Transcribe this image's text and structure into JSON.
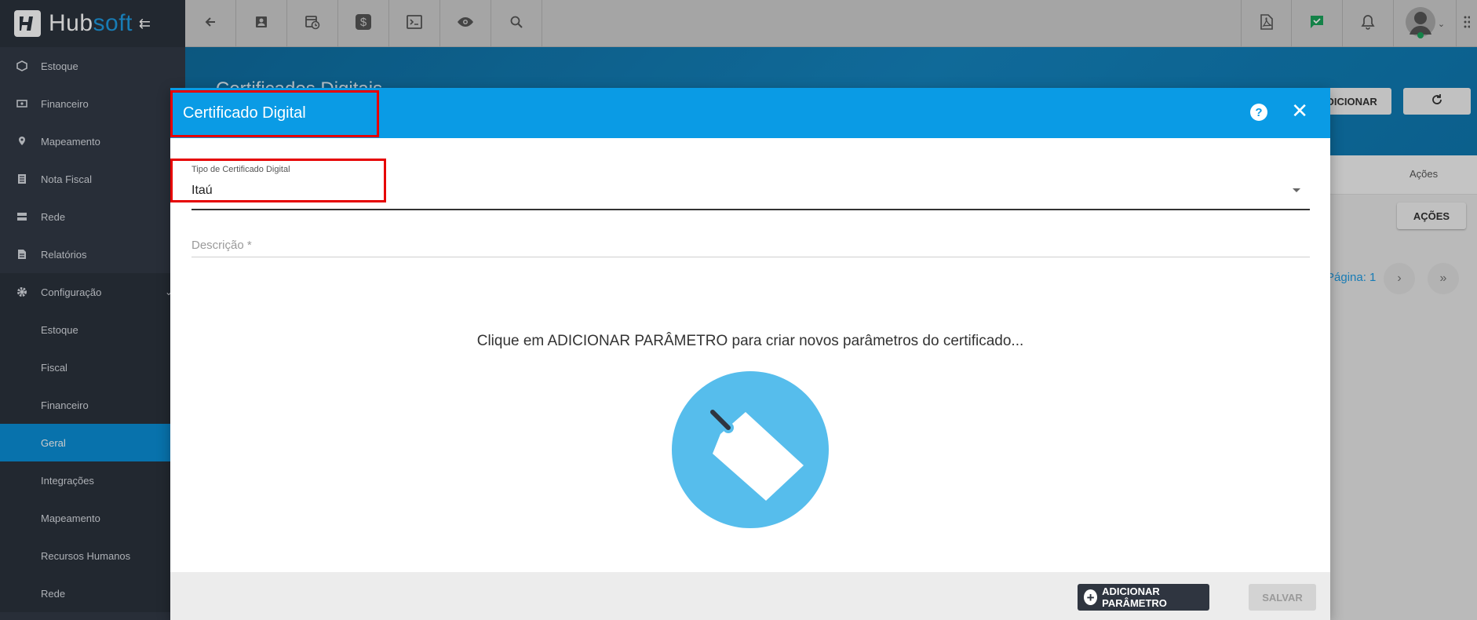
{
  "app": {
    "brand_hub": "Hub",
    "brand_soft": "soft"
  },
  "sidebar": {
    "items": [
      {
        "label": "Estoque",
        "icon": "box-icon"
      },
      {
        "label": "Financeiro",
        "icon": "money-icon"
      },
      {
        "label": "Mapeamento",
        "icon": "map-pin-icon"
      },
      {
        "label": "Nota Fiscal",
        "icon": "document-icon"
      },
      {
        "label": "Rede",
        "icon": "server-icon"
      },
      {
        "label": "Relatórios",
        "icon": "report-icon"
      },
      {
        "label": "Configuração",
        "icon": "gear-icon"
      }
    ],
    "sub_items": [
      {
        "label": "Estoque"
      },
      {
        "label": "Fiscal"
      },
      {
        "label": "Financeiro"
      },
      {
        "label": "Geral",
        "active": true
      },
      {
        "label": "Integrações"
      },
      {
        "label": "Mapeamento"
      },
      {
        "label": "Recursos Humanos"
      },
      {
        "label": "Rede"
      }
    ]
  },
  "page": {
    "title": "Certificados Digitais",
    "add_button": "ADICIONAR",
    "column_actions": "Ações",
    "row_actions_button": "AÇÕES",
    "pager_label": "Página: 1"
  },
  "modal": {
    "title": "Certificado Digital",
    "type_label": "Tipo de Certificado Digital",
    "type_value": "Itaú",
    "description_placeholder": "Descrição *",
    "empty_message": "Clique em ADICIONAR PARÂMETRO para criar novos parâmetros do certificado...",
    "add_param_button": "ADICIONAR PARÂMETRO",
    "save_button": "SALVAR"
  },
  "colors": {
    "primary": "#0a9be5",
    "sidebar_bg": "#323a47",
    "active_item": "#0a8fd7",
    "highlight": "#e60000"
  }
}
